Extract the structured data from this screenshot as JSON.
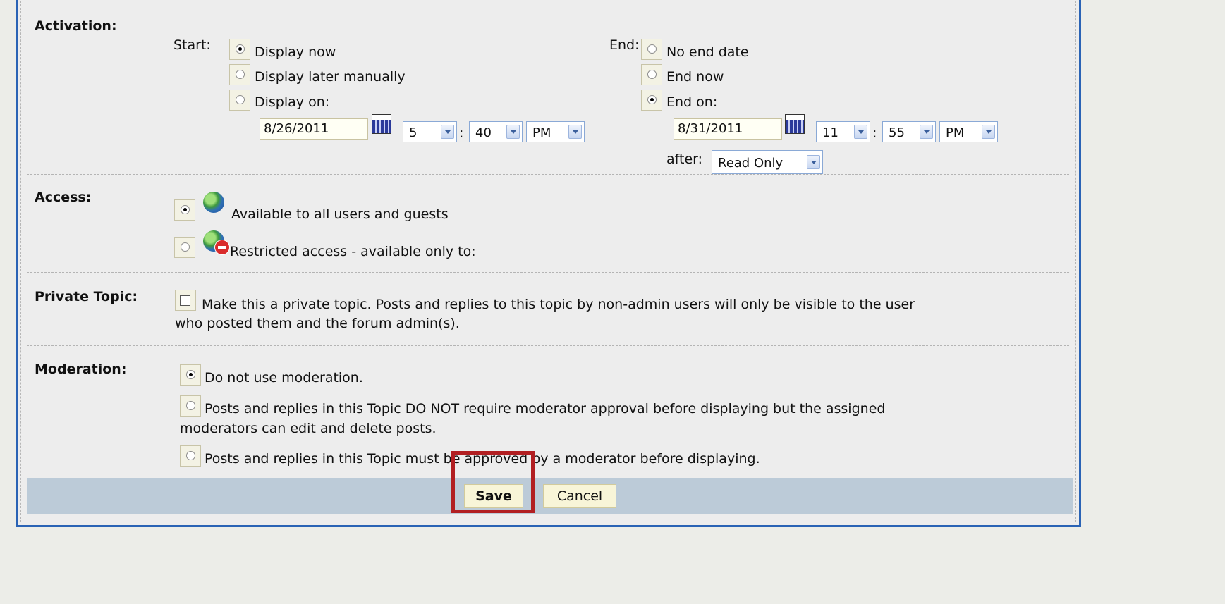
{
  "activation": {
    "label": "Activation:",
    "start_label": "Start:",
    "end_label": "End:",
    "start_options": [
      {
        "label": "Display now",
        "selected": true
      },
      {
        "label": "Display later manually",
        "selected": false
      },
      {
        "label": "Display on:",
        "selected": false
      }
    ],
    "end_options": [
      {
        "label": "No end date",
        "selected": false
      },
      {
        "label": "End now",
        "selected": false
      },
      {
        "label": "End on:",
        "selected": true
      }
    ],
    "start_date": "8/26/2011",
    "start_hour": "5",
    "start_minute": "40",
    "start_ampm": "PM",
    "end_date": "8/31/2011",
    "end_hour": "11",
    "end_minute": "55",
    "end_ampm": "PM",
    "after_label": "after:",
    "after_value": "Read Only",
    "time_separator": ":"
  },
  "access": {
    "label": "Access:",
    "options": [
      {
        "label": "Available to all users and guests",
        "selected": true,
        "icon": "globe-icon"
      },
      {
        "label": "Restricted access - available only to:",
        "selected": false,
        "icon": "restricted-globe-icon"
      }
    ]
  },
  "private_topic": {
    "label": "Private Topic:",
    "checked": false,
    "text_line1": "Make this a private topic. Posts and replies to this topic by non-admin users will only be visible to the user",
    "text_line2": "who posted them and the forum admin(s)."
  },
  "moderation": {
    "label": "Moderation:",
    "options": [
      {
        "line1": "Do not use moderation.",
        "line2": "",
        "selected": true
      },
      {
        "line1": "Posts and replies in this Topic DO NOT require moderator approval before displaying but the assigned",
        "line2": "moderators can edit and delete posts.",
        "selected": false
      },
      {
        "line1": "Posts and replies in this Topic must be approved by a moderator before displaying.",
        "line2": "",
        "selected": false
      }
    ]
  },
  "buttons": {
    "save": "Save",
    "cancel": "Cancel"
  },
  "colors": {
    "frame_border": "#2a63b5",
    "footer_bar": "#bccbd8",
    "highlight": "#b21f22"
  }
}
